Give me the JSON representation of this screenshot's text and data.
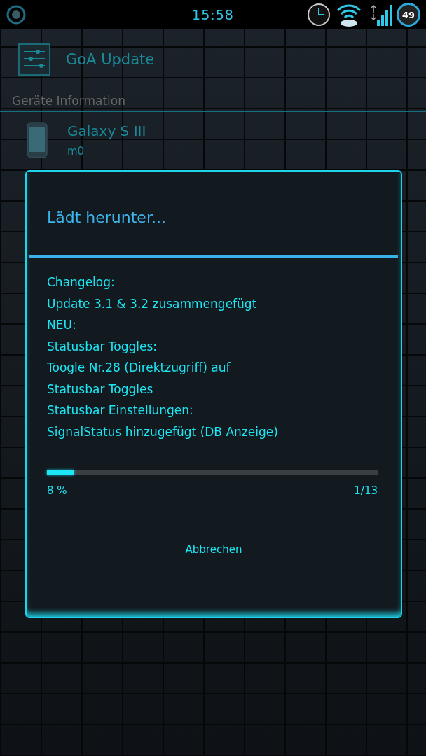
{
  "status_bar": {
    "time": "15:58",
    "battery": "49"
  },
  "app_bar": {
    "title": "GoA Update"
  },
  "section": {
    "title": "Geräte Information"
  },
  "device": {
    "name": "Galaxy S III",
    "model": "m0"
  },
  "dialog": {
    "title": "Lädt herunter...",
    "message": [
      "Changelog:",
      "Update 3.1 & 3.2 zusammengefügt",
      "NEU:",
      "Statusbar Toggles:",
      "Toogle Nr.28 (Direktzugriff) auf",
      "Statusbar Toggles",
      "Statusbar Einstellungen:",
      "SignalStatus hinzugefügt (DB Anzeige)"
    ],
    "progress": {
      "level": 0.08,
      "percent": "8 %",
      "count": "1/13"
    },
    "button": "Abbrechen"
  }
}
